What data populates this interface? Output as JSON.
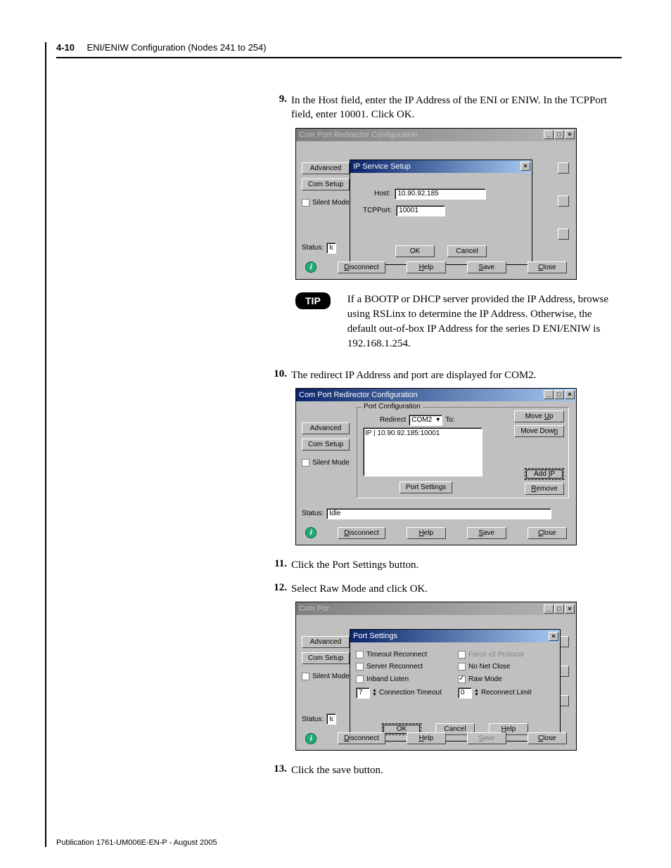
{
  "header": {
    "page_number": "4-10",
    "section": "ENI/ENIW Configuration (Nodes 241 to 254)"
  },
  "steps": {
    "s9": {
      "num": "9.",
      "text": "In the Host field, enter the IP Address of the ENI or ENIW. In the TCPPort field, enter 10001. Click OK."
    },
    "s10": {
      "num": "10.",
      "text": "The redirect IP Address and port are displayed for COM2."
    },
    "s11": {
      "num": "11.",
      "text": "Click the Port Settings button."
    },
    "s12": {
      "num": "12.",
      "text": "Select Raw Mode and click OK."
    },
    "s13": {
      "num": "13.",
      "text": "Click the save button."
    }
  },
  "tip": {
    "label": "TIP",
    "text": "If a BOOTP or DHCP server provided the IP Address, browse using RSLinx to determine the IP Address. Otherwise, the default out-of-box IP Address for the series D ENI/ENIW is 192.168.1.254."
  },
  "win_common": {
    "min": "_",
    "max": "□",
    "close": "×",
    "advanced": "Advanced",
    "com_setup": "Com Setup",
    "silent_mode": "Silent Mode",
    "status_label": "Status:",
    "idle": "Idle",
    "disconnect": "Disconnect",
    "help": "Help",
    "save": "Save",
    "close_btn": "Close",
    "ok": "OK",
    "cancel": "Cancel"
  },
  "win1": {
    "outer_title": "Com Port Redirector Configuration",
    "inner_title": "IP Service Setup",
    "host_label": "Host:",
    "host_value": "10.90.92.185",
    "tcp_label": "TCPPort:",
    "tcp_value": "10001",
    "status_cut": "Ic"
  },
  "win2": {
    "title": "Com Port Redirector Configuration",
    "group": "Port Configuration",
    "redirect_label": "Redirect",
    "redirect_value": "COM2",
    "to": "To:",
    "list_entry": "IP | 10.90.92.185:10001",
    "port_settings": "Port Settings",
    "move_up": "Move Up",
    "move_down": "Move Down",
    "add_ip": "Add IP",
    "remove": "Remove"
  },
  "win3": {
    "outer_title_cut": "Com Por",
    "inner_title": "Port Settings",
    "timeout_reconnect": "Timeout Reconnect",
    "server_reconnect": "Server Reconnect",
    "inband_listen": "Inband Listen",
    "force_v2": "Force v2 Protocol",
    "no_net_close": "No Net Close",
    "raw_mode": "Raw Mode",
    "conn_timeout_label": "Connection Timeout",
    "conn_timeout_val": "7",
    "reconn_limit_label": "Reconnect Limit",
    "reconn_limit_val": "0",
    "status_cut": "Ic"
  },
  "footer": "Publication 1761-UM006E-EN-P - August 2005"
}
